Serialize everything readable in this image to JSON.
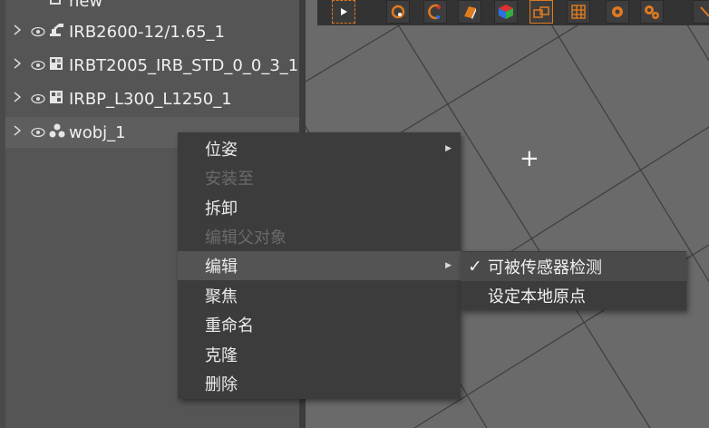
{
  "tree": {
    "items": [
      {
        "label": "new",
        "expanded": false
      },
      {
        "label": "IRB2600-12/1.65_1",
        "expanded": false
      },
      {
        "label": "IRBT2005_IRB_STD_0_0_3_1",
        "expanded": false
      },
      {
        "label": "IRBP_L300_L1250_1",
        "expanded": false
      },
      {
        "label": "wobj_1",
        "expanded": false
      }
    ]
  },
  "icons": {
    "chevron": "chevron-right-icon",
    "eye": "eye-icon",
    "accent": "#e07b20"
  },
  "viewport": {
    "crosshair": "+"
  },
  "context_menu": {
    "items": [
      {
        "label": "位姿",
        "disabled": false,
        "has_submenu": true
      },
      {
        "label": "安装至",
        "disabled": true,
        "has_submenu": false
      },
      {
        "label": "拆卸",
        "disabled": false,
        "has_submenu": false
      },
      {
        "label": "编辑父对象",
        "disabled": true,
        "has_submenu": false
      },
      {
        "label": "编辑",
        "disabled": false,
        "has_submenu": true,
        "hover": true
      },
      {
        "label": "聚焦",
        "disabled": false,
        "has_submenu": false
      },
      {
        "label": "重命名",
        "disabled": false,
        "has_submenu": false
      },
      {
        "label": "克隆",
        "disabled": false,
        "has_submenu": false
      },
      {
        "label": "删除",
        "disabled": false,
        "has_submenu": false
      }
    ]
  },
  "submenu": {
    "items": [
      {
        "label": "可被传感器检测",
        "checked": true,
        "check_mark": "✓"
      },
      {
        "label": "设定本地原点",
        "checked": false,
        "check_mark": ""
      }
    ]
  }
}
